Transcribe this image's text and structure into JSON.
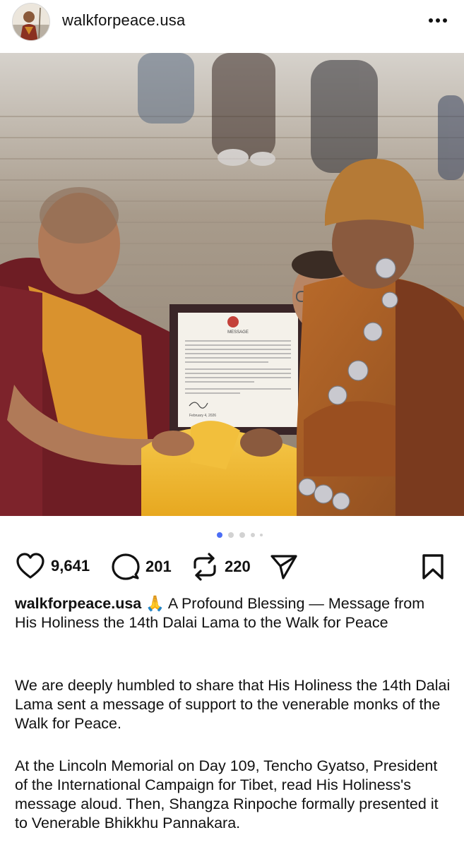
{
  "post": {
    "username": "walkforpeace.usa",
    "avatar_icon": "monk-avatar-icon",
    "more_icon": "more-horizontal-icon"
  },
  "carousel": {
    "slide_count": 5,
    "active_index": 0,
    "active_color": "#4c6ef5"
  },
  "photo": {
    "certificate": {
      "heading": "MESSAGE",
      "date": "February 4, 2026"
    }
  },
  "actions": {
    "likes": "9,641",
    "comments": "201",
    "reposts": "220",
    "icons": [
      "heart-icon",
      "comment-icon",
      "repost-icon",
      "share-icon",
      "bookmark-icon"
    ]
  },
  "caption": {
    "username": "walkforpeace.usa",
    "emoji": "🙏",
    "text": "A Profound Blessing — Message from His Holiness the 14th Dalai Lama to the Walk for Peace"
  },
  "body": {
    "paragraph1": "We are deeply humbled to share that His Holiness the 14th Dalai Lama sent a message of support to the venerable monks of the Walk for Peace.",
    "paragraph2": "At the Lincoln Memorial on Day 109, Tencho Gyatso, President of the International Campaign for Tibet, read His Holiness's message aloud. Then, Shangza Rinpoche formally presented it to Venerable Bhikkhu Pannakara."
  }
}
